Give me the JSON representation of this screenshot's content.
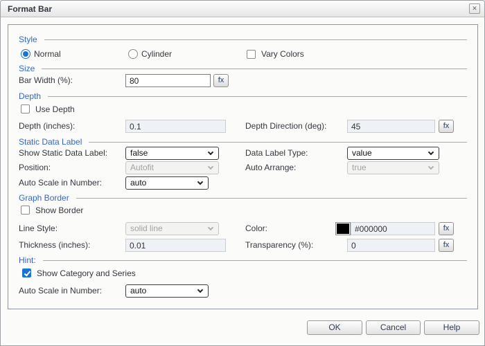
{
  "dialog": {
    "title": "Format Bar",
    "close_glyph": "✕"
  },
  "common": {
    "fx": "fx"
  },
  "style": {
    "heading": "Style",
    "normal": "Normal",
    "cylinder": "Cylinder",
    "vary_colors": "Vary Colors"
  },
  "size": {
    "heading": "Size",
    "bar_width_label": "Bar Width (%):",
    "bar_width_value": "80"
  },
  "depth": {
    "heading": "Depth",
    "use_depth": "Use Depth",
    "depth_label": "Depth (inches):",
    "depth_value": "0.1",
    "direction_label": "Depth Direction (deg):",
    "direction_value": "45"
  },
  "static_data_label": {
    "heading": "Static Data Label",
    "show_label": "Show Static Data Label:",
    "show_value": "false",
    "type_label": "Data Label Type:",
    "type_value": "value",
    "position_label": "Position:",
    "position_value": "Autofit",
    "arrange_label": "Auto Arrange:",
    "arrange_value": "true",
    "autoscale_label": "Auto Scale in Number:",
    "autoscale_value": "auto"
  },
  "graph_border": {
    "heading": "Graph Border",
    "show_border": "Show Border",
    "line_style_label": "Line Style:",
    "line_style_value": "solid line",
    "color_label": "Color:",
    "color_value": "#000000",
    "swatch_color": "#000000",
    "thickness_label": "Thickness (inches):",
    "thickness_value": "0.01",
    "transparency_label": "Transparency (%):",
    "transparency_value": "0"
  },
  "hint": {
    "heading": "Hint:",
    "show_category": "Show Category and Series",
    "autoscale_label": "Auto Scale in Number:",
    "autoscale_value": "auto"
  },
  "buttons": {
    "ok": "OK",
    "cancel": "Cancel",
    "help": "Help"
  },
  "colors": {
    "heading_blue": "#3366cc",
    "control_blue": "#1a73d2",
    "swatch": "#000000"
  }
}
